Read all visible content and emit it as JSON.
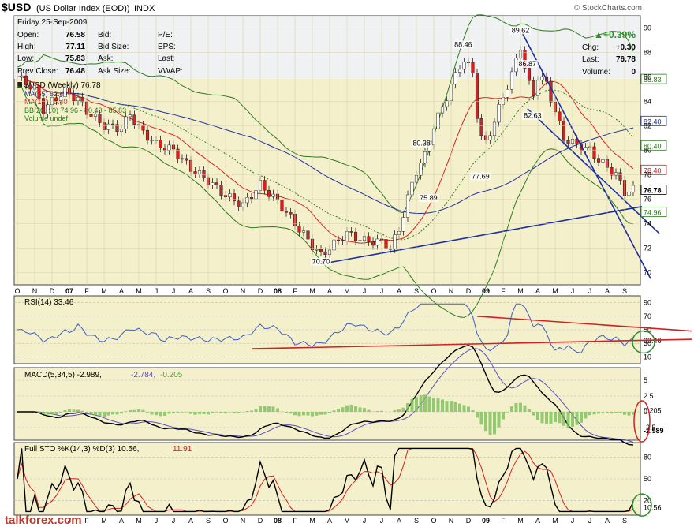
{
  "header": {
    "title": "$USD",
    "name": "(US Dollar Index (EOD))",
    "exchange": "INDX",
    "source": "© StockCharts.com"
  },
  "quote": {
    "date": "Friday  25-Sep-2009",
    "open_label": "Open:",
    "open": "76.58",
    "high_label": "High:",
    "high": "77.11",
    "low_label": "Low:",
    "low": "75.83",
    "prev_label": "Prev Close:",
    "prev": "76.48",
    "bid_label": "Bid:",
    "bidsize_label": "Bid Size:",
    "ask_label": "Ask:",
    "asksize_label": "Ask Size:",
    "pe_label": "P/E:",
    "eps_label": "EPS:",
    "last_label2": "Last:",
    "vwap_label": "VWAP:",
    "change_pct": "▲+0.39%",
    "chg_label": "Chg:",
    "chg": "+0.30",
    "last_label": "Last:",
    "last": "76.78",
    "vol_label": "Volume:",
    "volume": "0",
    "up_color": "#2e8b2e"
  },
  "watermark": "talkforex.com",
  "chart_data": [
    {
      "type": "candlestick",
      "title": "$USD (Weekly) 76.78",
      "legend": [
        {
          "name": "MA(55) 82.40",
          "color": "#1a2ea0"
        },
        {
          "name": "MA(13) 78.40",
          "color": "#d42020"
        },
        {
          "name": "BB(26,2.0) 74.96 - 80.40 - 85.83",
          "color": "#2a7a1a"
        },
        {
          "name": "Volume undef",
          "color": "#2a7a1a"
        }
      ],
      "y_ticks": [
        70,
        72,
        74,
        76,
        78,
        80,
        82,
        84,
        86,
        88,
        90
      ],
      "ylim": [
        69,
        91
      ],
      "x_ticks": [
        "O",
        "N",
        "D",
        "07",
        "F",
        "M",
        "A",
        "M",
        "J",
        "J",
        "A",
        "S",
        "O",
        "N",
        "D",
        "08",
        "F",
        "M",
        "A",
        "M",
        "J",
        "J",
        "A",
        "S",
        "O",
        "N",
        "D",
        "09",
        "F",
        "M",
        "A",
        "M",
        "J",
        "J",
        "A",
        "S"
      ],
      "annotations": [
        {
          "label": "70.70",
          "value": 70.7,
          "month": 17.5
        },
        {
          "label": "75.89",
          "value": 75.89,
          "month": 23.7
        },
        {
          "label": "80.38",
          "value": 80.38,
          "month": 23.3
        },
        {
          "label": "88.46",
          "value": 88.46,
          "month": 25.7
        },
        {
          "label": "77.69",
          "value": 77.69,
          "month": 26.7
        },
        {
          "label": "89.62",
          "value": 89.62,
          "month": 29.0
        },
        {
          "label": "86.87",
          "value": 86.87,
          "month": 29.4
        },
        {
          "label": "82.63",
          "value": 82.63,
          "month": 29.7
        }
      ],
      "price_boxes": [
        {
          "label": "85.83",
          "value": 85.83,
          "bg": "#ffffff",
          "fg": "#2a7a1a"
        },
        {
          "label": "82.40",
          "value": 82.4,
          "bg": "#ffffff",
          "fg": "#1a2ea0"
        },
        {
          "label": "80.40",
          "value": 80.4,
          "bg": "#ffffff",
          "fg": "#2a7a1a"
        },
        {
          "label": "78.40",
          "value": 78.4,
          "bg": "#ffffff",
          "fg": "#d42020"
        },
        {
          "label": "76.78",
          "value": 76.78,
          "bg": "#ffffff",
          "fg": "#000000"
        },
        {
          "label": "74.96",
          "value": 74.96,
          "bg": "#ffffff",
          "fg": "#2a7a1a"
        }
      ],
      "price_path": [
        [
          0,
          86
        ],
        [
          1,
          85
        ],
        [
          1.5,
          83.3
        ],
        [
          2,
          84
        ],
        [
          2.7,
          84.8
        ],
        [
          3.5,
          84.2
        ],
        [
          4,
          83.2
        ],
        [
          5,
          82
        ],
        [
          6,
          81.8
        ],
        [
          6.5,
          83
        ],
        [
          7,
          81.8
        ],
        [
          8,
          80.5
        ],
        [
          9,
          80
        ],
        [
          10,
          78.5
        ],
        [
          11,
          77.5
        ],
        [
          12,
          76.3
        ],
        [
          13,
          75.5
        ],
        [
          14,
          77.2
        ],
        [
          15,
          75.8
        ],
        [
          16,
          74
        ],
        [
          17,
          72.2
        ],
        [
          17.5,
          71.4
        ],
        [
          18.3,
          72.4
        ],
        [
          19,
          73.2
        ],
        [
          20,
          72.6
        ],
        [
          21,
          72.5
        ],
        [
          21.5,
          72
        ],
        [
          22,
          73.5
        ],
        [
          22.6,
          76.6
        ],
        [
          23,
          78.3
        ],
        [
          23.6,
          79.8
        ],
        [
          24,
          82
        ],
        [
          24.5,
          83.5
        ],
        [
          25,
          85.3
        ],
        [
          25.7,
          87.5
        ],
        [
          26.3,
          86.2
        ],
        [
          26.6,
          81.3
        ],
        [
          27,
          80.6
        ],
        [
          27.5,
          82.4
        ],
        [
          28,
          84.4
        ],
        [
          28.5,
          86.2
        ],
        [
          29,
          88.5
        ],
        [
          29.3,
          86.4
        ],
        [
          29.7,
          84.3
        ],
        [
          30,
          86
        ],
        [
          30.5,
          85.5
        ],
        [
          31,
          83.1
        ],
        [
          31.5,
          81
        ],
        [
          32,
          80.6
        ],
        [
          33,
          80
        ],
        [
          33.5,
          79.2
        ],
        [
          34,
          78.6
        ],
        [
          34.5,
          78
        ],
        [
          35,
          76.6
        ],
        [
          35.5,
          76.78
        ]
      ],
      "blue_lines": [
        {
          "from": [
            17.5,
            70.7
          ],
          "to": [
            36,
            75.4
          ]
        },
        {
          "from": [
            29.1,
            89.6
          ],
          "to": [
            36.5,
            69.5
          ]
        },
        {
          "from": [
            29.4,
            83.4
          ],
          "to": [
            37,
            73.2
          ]
        }
      ]
    },
    {
      "type": "line",
      "title": "RSI(14) 33.46",
      "y_ticks": [
        10,
        30,
        50,
        70,
        90
      ],
      "ylim": [
        0,
        100
      ],
      "last_label": "33.46"
    },
    {
      "type": "line",
      "title": "MACD(5,34,5) -2.989, -2.784, -0.205",
      "title_parts": [
        "MACD(5,34,5) -2.989,",
        "-2.784,",
        "-0.205"
      ],
      "y_ticks": [
        -2.5,
        0.0,
        2.5,
        5.0
      ],
      "ylim": [
        -4.5,
        7
      ],
      "labels": [
        "0.205",
        "-2.989"
      ]
    },
    {
      "type": "line",
      "title": "Full STO %K(14,3) %D(3) 10.56, 11.91",
      "title_parts": [
        "Full STO %K(14,3) %D(3) 10.56,",
        "11.91"
      ],
      "y_ticks": [
        20,
        50,
        80
      ],
      "ylim": [
        0,
        100
      ],
      "last_label": "10.56"
    }
  ],
  "bottom_axis": [
    "J",
    "F",
    "M",
    "A",
    "M",
    "J",
    "J",
    "A",
    "S",
    "O",
    "N",
    "D",
    "08",
    "F",
    "M",
    "A",
    "M",
    "J",
    "J",
    "A",
    "S",
    "O",
    "N",
    "D",
    "09",
    "F",
    "M",
    "A",
    "M",
    "J",
    "J",
    "A",
    "S"
  ]
}
